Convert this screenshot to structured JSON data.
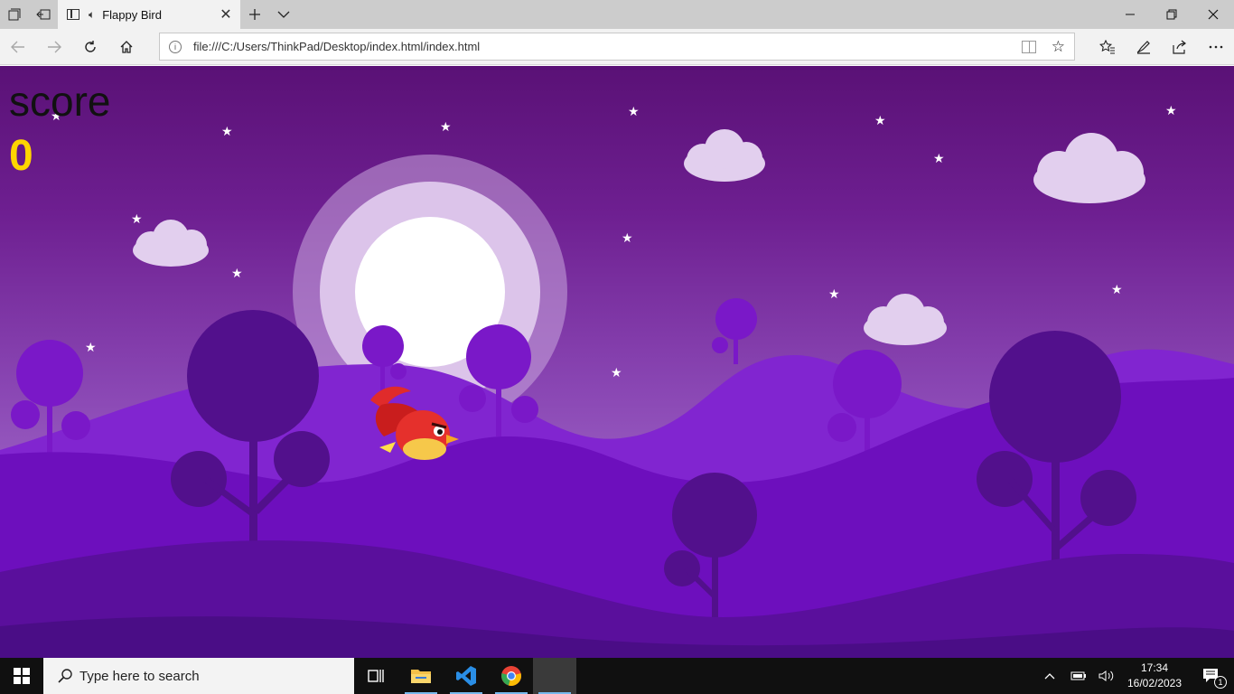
{
  "browser": {
    "tab": {
      "title": "Flappy Bird"
    },
    "address": {
      "url": "file:///C:/Users/ThinkPad/Desktop/index.html/index.html"
    }
  },
  "game": {
    "score_label": "score",
    "score_value": "0",
    "colors": {
      "score_value": "#ffd500",
      "sky": "#6e1f91",
      "hills": "#6b0fb7"
    }
  },
  "taskbar": {
    "search_placeholder": "Type here to search",
    "time": "17:34",
    "date": "16/02/2023",
    "notification_count": "1"
  }
}
